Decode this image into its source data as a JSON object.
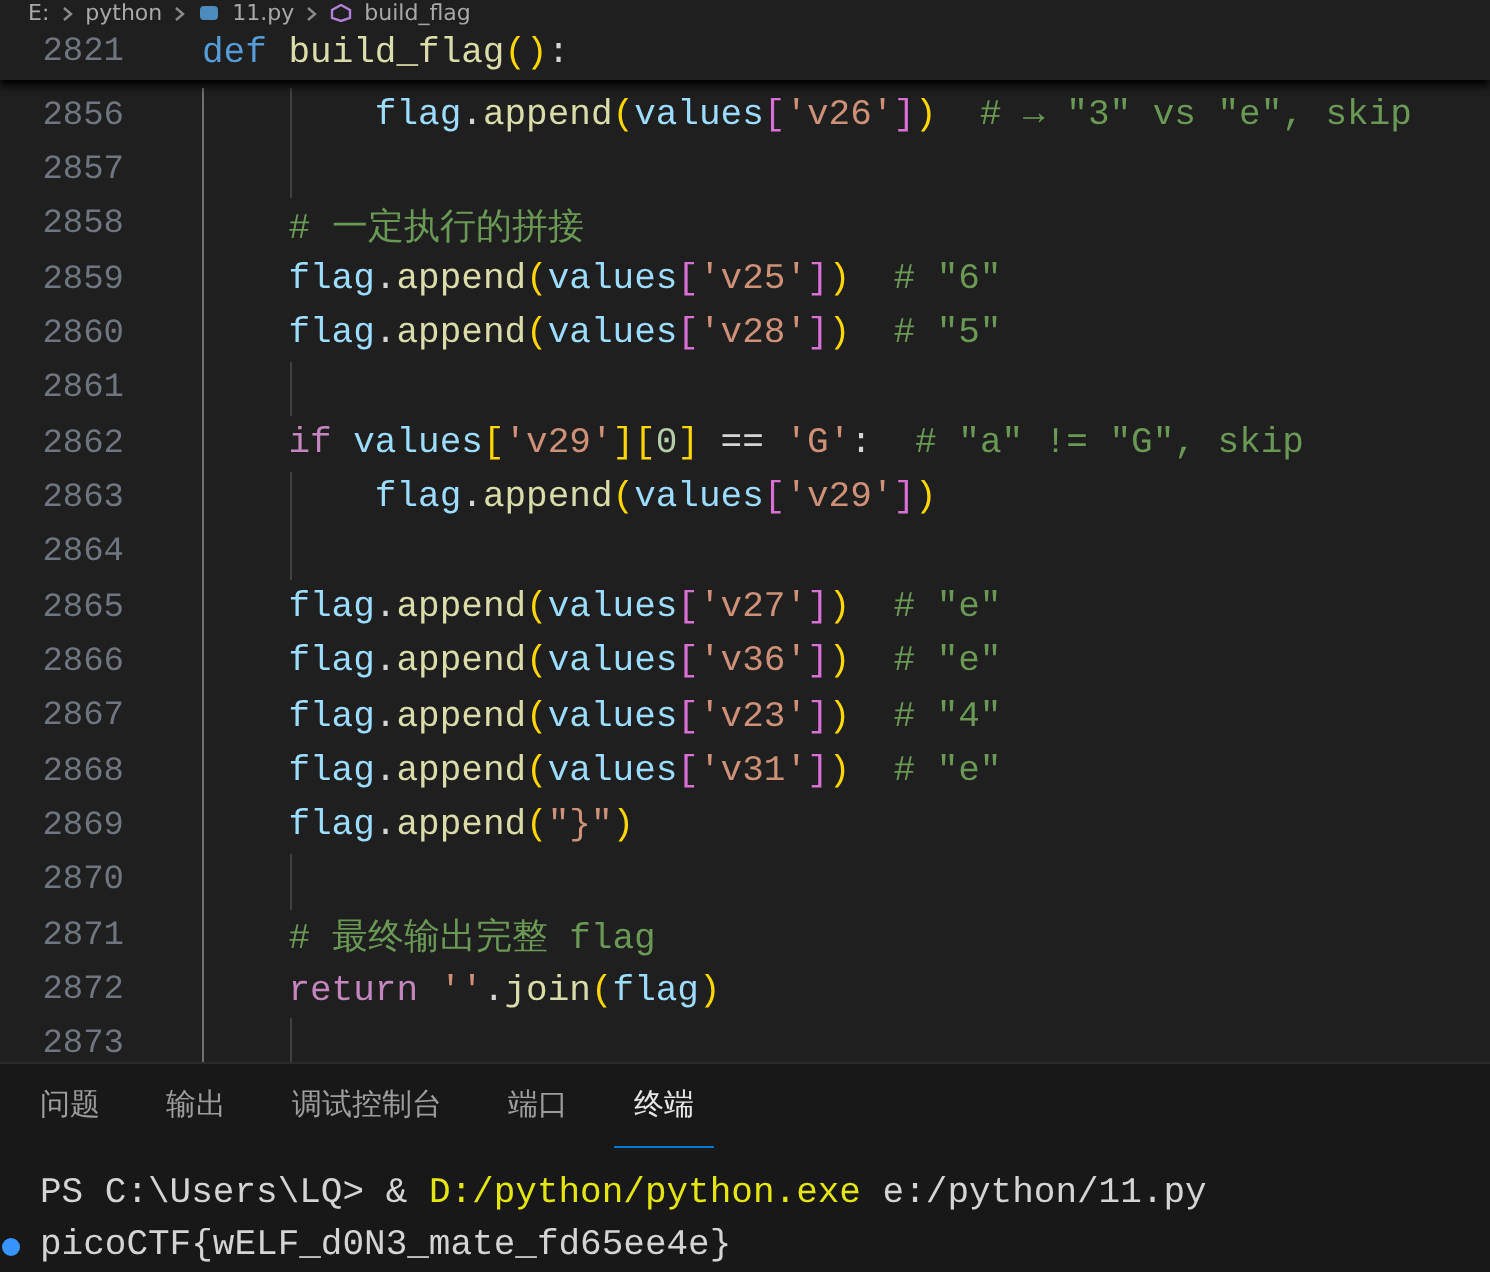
{
  "breadcrumb": [
    {
      "kind": "folder",
      "label": "E:"
    },
    {
      "kind": "folder",
      "label": "python"
    },
    {
      "kind": "file",
      "label": "11.py"
    },
    {
      "kind": "symbol",
      "label": "build_flag"
    }
  ],
  "sticky_line": {
    "number": "2821",
    "tokens": [
      {
        "kind": "keyword",
        "text": "def "
      },
      {
        "kind": "function",
        "text": "build_flag"
      },
      {
        "kind": "bracket1",
        "text": "()"
      },
      {
        "kind": "plain",
        "text": ":"
      }
    ]
  },
  "lines": [
    {
      "number": "2856",
      "tokens": [
        {
          "kind": "variable",
          "text": "        flag"
        },
        {
          "kind": "plain",
          "text": "."
        },
        {
          "kind": "function",
          "text": "append"
        },
        {
          "kind": "bracket1",
          "text": "("
        },
        {
          "kind": "variable",
          "text": "values"
        },
        {
          "kind": "bracket2",
          "text": "["
        },
        {
          "kind": "string",
          "text": "'v26'"
        },
        {
          "kind": "bracket2",
          "text": "]"
        },
        {
          "kind": "bracket1",
          "text": ")"
        },
        {
          "kind": "comment",
          "text": "  # → \"3\" vs \"e\", skip"
        }
      ]
    },
    {
      "number": "2857"
    },
    {
      "number": "2858",
      "tokens": [
        {
          "kind": "comment",
          "text": "    # 一定执行的拼接"
        }
      ]
    },
    {
      "number": "2859",
      "tokens": [
        {
          "kind": "variable",
          "text": "    flag"
        },
        {
          "kind": "plain",
          "text": "."
        },
        {
          "kind": "function",
          "text": "append"
        },
        {
          "kind": "bracket1",
          "text": "("
        },
        {
          "kind": "variable",
          "text": "values"
        },
        {
          "kind": "bracket2",
          "text": "["
        },
        {
          "kind": "string",
          "text": "'v25'"
        },
        {
          "kind": "bracket2",
          "text": "]"
        },
        {
          "kind": "bracket1",
          "text": ")"
        },
        {
          "kind": "comment",
          "text": "  # \"6\""
        }
      ]
    },
    {
      "number": "2860",
      "tokens": [
        {
          "kind": "variable",
          "text": "    flag"
        },
        {
          "kind": "plain",
          "text": "."
        },
        {
          "kind": "function",
          "text": "append"
        },
        {
          "kind": "bracket1",
          "text": "("
        },
        {
          "kind": "variable",
          "text": "values"
        },
        {
          "kind": "bracket2",
          "text": "["
        },
        {
          "kind": "string",
          "text": "'v28'"
        },
        {
          "kind": "bracket2",
          "text": "]"
        },
        {
          "kind": "bracket1",
          "text": ")"
        },
        {
          "kind": "comment",
          "text": "  # \"5\""
        }
      ]
    },
    {
      "number": "2861"
    },
    {
      "number": "2862",
      "tokens": [
        {
          "kind": "control",
          "text": "    if "
        },
        {
          "kind": "variable",
          "text": "values"
        },
        {
          "kind": "bracket1",
          "text": "["
        },
        {
          "kind": "string",
          "text": "'v29'"
        },
        {
          "kind": "bracket1",
          "text": "]["
        },
        {
          "kind": "number",
          "text": "0"
        },
        {
          "kind": "bracket1",
          "text": "]"
        },
        {
          "kind": "plain",
          "text": " == "
        },
        {
          "kind": "string",
          "text": "'G'"
        },
        {
          "kind": "plain",
          "text": ":"
        },
        {
          "kind": "comment",
          "text": "  # \"a\" != \"G\", skip"
        }
      ]
    },
    {
      "number": "2863",
      "tokens": [
        {
          "kind": "variable",
          "text": "        flag"
        },
        {
          "kind": "plain",
          "text": "."
        },
        {
          "kind": "function",
          "text": "append"
        },
        {
          "kind": "bracket1",
          "text": "("
        },
        {
          "kind": "variable",
          "text": "values"
        },
        {
          "kind": "bracket2",
          "text": "["
        },
        {
          "kind": "string",
          "text": "'v29'"
        },
        {
          "kind": "bracket2",
          "text": "]"
        },
        {
          "kind": "bracket1",
          "text": ")"
        }
      ]
    },
    {
      "number": "2864"
    },
    {
      "number": "2865",
      "tokens": [
        {
          "kind": "variable",
          "text": "    flag"
        },
        {
          "kind": "plain",
          "text": "."
        },
        {
          "kind": "function",
          "text": "append"
        },
        {
          "kind": "bracket1",
          "text": "("
        },
        {
          "kind": "variable",
          "text": "values"
        },
        {
          "kind": "bracket2",
          "text": "["
        },
        {
          "kind": "string",
          "text": "'v27'"
        },
        {
          "kind": "bracket2",
          "text": "]"
        },
        {
          "kind": "bracket1",
          "text": ")"
        },
        {
          "kind": "comment",
          "text": "  # \"e\""
        }
      ]
    },
    {
      "number": "2866",
      "tokens": [
        {
          "kind": "variable",
          "text": "    flag"
        },
        {
          "kind": "plain",
          "text": "."
        },
        {
          "kind": "function",
          "text": "append"
        },
        {
          "kind": "bracket1",
          "text": "("
        },
        {
          "kind": "variable",
          "text": "values"
        },
        {
          "kind": "bracket2",
          "text": "["
        },
        {
          "kind": "string",
          "text": "'v36'"
        },
        {
          "kind": "bracket2",
          "text": "]"
        },
        {
          "kind": "bracket1",
          "text": ")"
        },
        {
          "kind": "comment",
          "text": "  # \"e\""
        }
      ]
    },
    {
      "number": "2867",
      "tokens": [
        {
          "kind": "variable",
          "text": "    flag"
        },
        {
          "kind": "plain",
          "text": "."
        },
        {
          "kind": "function",
          "text": "append"
        },
        {
          "kind": "bracket1",
          "text": "("
        },
        {
          "kind": "variable",
          "text": "values"
        },
        {
          "kind": "bracket2",
          "text": "["
        },
        {
          "kind": "string",
          "text": "'v23'"
        },
        {
          "kind": "bracket2",
          "text": "]"
        },
        {
          "kind": "bracket1",
          "text": ")"
        },
        {
          "kind": "comment",
          "text": "  # \"4\""
        }
      ]
    },
    {
      "number": "2868",
      "tokens": [
        {
          "kind": "variable",
          "text": "    flag"
        },
        {
          "kind": "plain",
          "text": "."
        },
        {
          "kind": "function",
          "text": "append"
        },
        {
          "kind": "bracket1",
          "text": "("
        },
        {
          "kind": "variable",
          "text": "values"
        },
        {
          "kind": "bracket2",
          "text": "["
        },
        {
          "kind": "string",
          "text": "'v31'"
        },
        {
          "kind": "bracket2",
          "text": "]"
        },
        {
          "kind": "bracket1",
          "text": ")"
        },
        {
          "kind": "comment",
          "text": "  # \"e\""
        }
      ]
    },
    {
      "number": "2869",
      "tokens": [
        {
          "kind": "variable",
          "text": "    flag"
        },
        {
          "kind": "plain",
          "text": "."
        },
        {
          "kind": "function",
          "text": "append"
        },
        {
          "kind": "bracket1",
          "text": "("
        },
        {
          "kind": "string",
          "text": "\"}\""
        },
        {
          "kind": "bracket1",
          "text": ")"
        }
      ]
    },
    {
      "number": "2870"
    },
    {
      "number": "2871",
      "tokens": [
        {
          "kind": "comment",
          "text": "    # 最终输出完整 flag"
        }
      ]
    },
    {
      "number": "2872",
      "tokens": [
        {
          "kind": "control",
          "text": "    return "
        },
        {
          "kind": "string",
          "text": "''"
        },
        {
          "kind": "plain",
          "text": "."
        },
        {
          "kind": "function",
          "text": "join"
        },
        {
          "kind": "bracket1",
          "text": "("
        },
        {
          "kind": "variable",
          "text": "flag"
        },
        {
          "kind": "bracket1",
          "text": ")"
        }
      ]
    },
    {
      "number": "2873"
    }
  ],
  "panel_tabs": [
    {
      "label": "问题",
      "selected": false
    },
    {
      "label": "输出",
      "selected": false
    },
    {
      "label": "调试控制台",
      "selected": false
    },
    {
      "label": "端口",
      "selected": false
    },
    {
      "label": "终端",
      "selected": true
    }
  ],
  "terminal": [
    {
      "decorated": false,
      "parts": [
        {
          "kind": "plain",
          "text": "PS C:\\Users\\LQ> & "
        },
        {
          "kind": "command",
          "text": "D:/python/python.exe"
        },
        {
          "kind": "plain",
          "text": " e:/python/11.py"
        }
      ]
    },
    {
      "decorated": true,
      "parts": [
        {
          "kind": "plain",
          "text": "picoCTF{wELF_d0N3_mate_fd65ee4e}"
        }
      ]
    }
  ]
}
